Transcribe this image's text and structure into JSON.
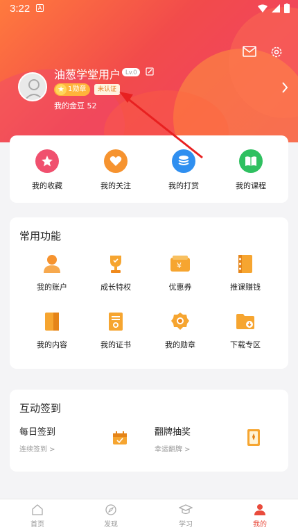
{
  "status_bar": {
    "time": "3:22",
    "notif_glyph": "A"
  },
  "header": {
    "username": "油葱学堂用户",
    "level": "Lv.0",
    "medal_text": "1勋章",
    "verify_text": "未认证",
    "gold_beans": "我的金豆 52"
  },
  "quick_actions": [
    {
      "label": "我的收藏",
      "icon": "star-icon",
      "color": "#f0506e"
    },
    {
      "label": "我的关注",
      "icon": "heart-icon",
      "color": "#f6932f"
    },
    {
      "label": "我的打赏",
      "icon": "coins-icon",
      "color": "#2f8ff0"
    },
    {
      "label": "我的课程",
      "icon": "book-icon",
      "color": "#2fc060"
    }
  ],
  "common_functions": {
    "title": "常用功能",
    "items": [
      {
        "label": "我的账户",
        "icon": "user-icon"
      },
      {
        "label": "成长特权",
        "icon": "trophy-icon"
      },
      {
        "label": "优惠券",
        "icon": "coupon-icon"
      },
      {
        "label": "推课赚钱",
        "icon": "notebook-icon"
      },
      {
        "label": "我的内容",
        "icon": "document-icon"
      },
      {
        "label": "我的证书",
        "icon": "certificate-icon"
      },
      {
        "label": "我的勋章",
        "icon": "medal-icon"
      },
      {
        "label": "下载专区",
        "icon": "folder-download-icon"
      }
    ]
  },
  "interactive_signin": {
    "title": "互动签到",
    "daily": {
      "title": "每日签到",
      "sub": "连续签到 >"
    },
    "flip": {
      "title": "翻牌抽奖",
      "sub": "幸运翻牌 >"
    }
  },
  "tabbar": [
    {
      "label": "首页",
      "icon": "home-icon",
      "active": false
    },
    {
      "label": "发现",
      "icon": "compass-icon",
      "active": false
    },
    {
      "label": "学习",
      "icon": "graduation-cap-icon",
      "active": false
    },
    {
      "label": "我的",
      "icon": "person-icon",
      "active": true
    }
  ],
  "colors": {
    "accent": "#e94b3c",
    "header_start": "#ff7a3d",
    "header_end": "#f0406b"
  }
}
